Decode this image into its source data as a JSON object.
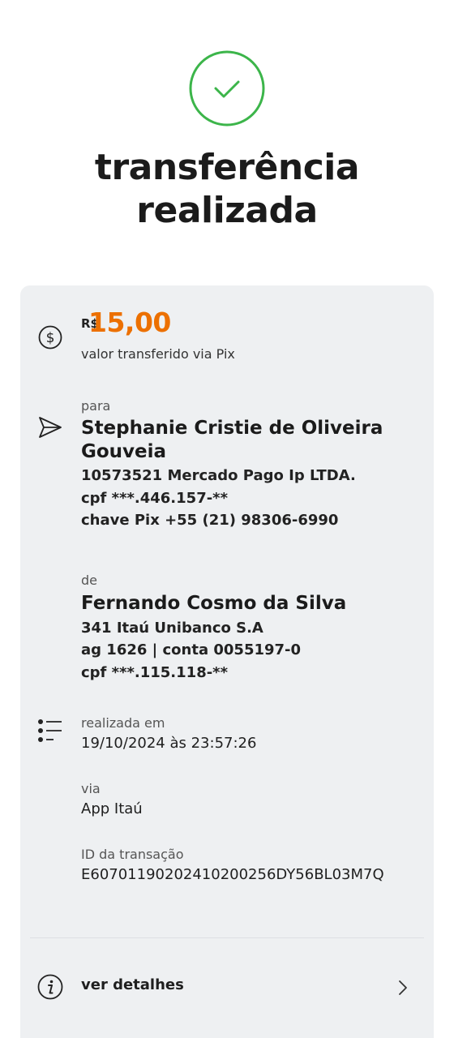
{
  "status": {
    "title_line1": "transferência",
    "title_line2": "realizada",
    "icon": "check-circle-icon",
    "accent_color": "#3cb54a"
  },
  "amount": {
    "currency": "R$",
    "value": "15,00",
    "caption": "valor transferido via Pix",
    "color": "#ec7000"
  },
  "recipient": {
    "label": "para",
    "name_line1": "Stephanie Cristie de Oliveira",
    "name_line2": "Gouveia",
    "bank": "10573521 Mercado Pago Ip LTDA.",
    "cpf": "cpf ***.446.157-**",
    "pix_key": "chave Pix +55 (21) 98306-6990"
  },
  "sender": {
    "label": "de",
    "name": "Fernando Cosmo da Silva",
    "bank": "341 Itaú Unibanco S.A",
    "account": "ag 1626 | conta 0055197-0",
    "cpf": "cpf ***.115.118-**"
  },
  "info": {
    "date_label": "realizada em",
    "date_value": "19/10/2024 às 23:57:26",
    "via_label": "via",
    "via_value": "App Itaú",
    "id_label": "ID da transação",
    "id_value": "E60701190202410200256DY56BL03M7Q"
  },
  "details": {
    "label": "ver detalhes"
  }
}
